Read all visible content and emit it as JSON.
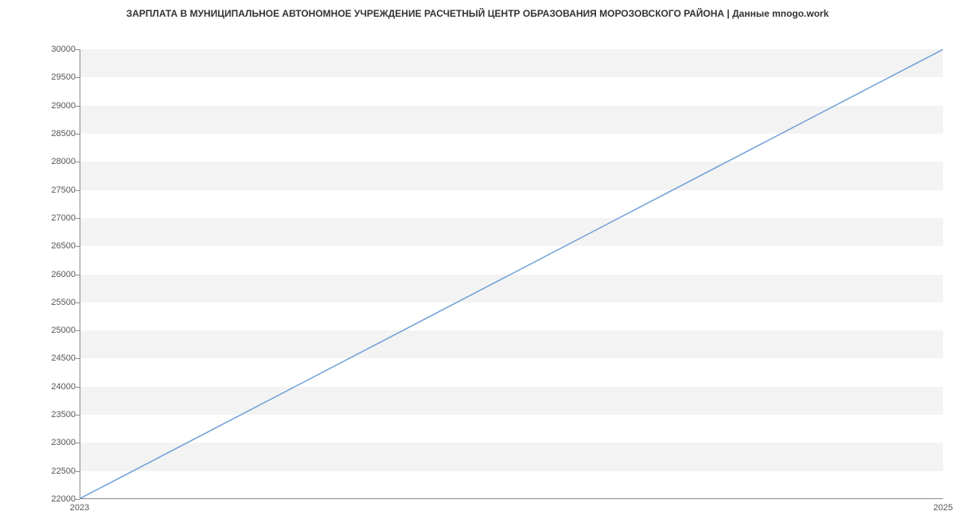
{
  "chart_data": {
    "type": "line",
    "title": "ЗАРПЛАТА В МУНИЦИПАЛЬНОЕ АВТОНОМНОЕ УЧРЕЖДЕНИЕ РАСЧЕТНЫЙ ЦЕНТР ОБРАЗОВАНИЯ МОРОЗОВСКОГО РАЙОНА | Данные mnogo.work",
    "x": [
      2023,
      2025
    ],
    "values": [
      22000,
      30000
    ],
    "xlabel": "",
    "ylabel": "",
    "xlim": [
      2023,
      2025
    ],
    "ylim": [
      22000,
      30000
    ],
    "x_ticks": [
      2023,
      2025
    ],
    "y_ticks": [
      22000,
      22500,
      23000,
      23500,
      24000,
      24500,
      25000,
      25500,
      26000,
      26500,
      27000,
      27500,
      28000,
      28500,
      29000,
      29500,
      30000
    ],
    "line_color": "#6f9fd8",
    "band_color": "#f3f3f3"
  }
}
